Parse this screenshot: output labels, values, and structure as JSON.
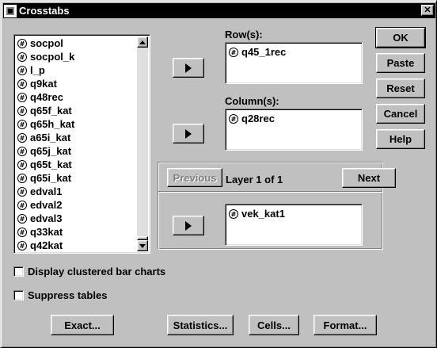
{
  "window": {
    "title": "Crosstabs",
    "close_glyph": "✕"
  },
  "variables": [
    "socpol",
    "socpol_k",
    "l_p",
    "q9kat",
    "q48rec",
    "q65f_kat",
    "q65h_kat",
    "a65i_kat",
    "q65j_kat",
    "q65t_kat",
    "q65i_kat",
    "edval1",
    "edval2",
    "edval3",
    "q33kat",
    "q42kat"
  ],
  "rows": {
    "label": "Row(s):",
    "items": [
      "q45_1rec"
    ]
  },
  "columns": {
    "label": "Column(s):",
    "items": [
      "q28rec"
    ]
  },
  "layer": {
    "previous_label": "Previous",
    "status": "Layer 1 of 1",
    "next_label": "Next",
    "items": [
      "vek_kat1"
    ]
  },
  "side_buttons": {
    "ok": "OK",
    "paste": "Paste",
    "reset": "Reset",
    "cancel": "Cancel",
    "help": "Help"
  },
  "options": {
    "clustered_bar": {
      "label": "Display clustered bar charts",
      "checked": false
    },
    "suppress_tables": {
      "label": "Suppress tables",
      "checked": false
    }
  },
  "bottom_buttons": {
    "exact": "Exact...",
    "statistics": "Statistics...",
    "cells": "Cells...",
    "format": "Format..."
  },
  "icons": {
    "variable": "numeric-variable-icon",
    "move": "right-arrow-icon"
  }
}
